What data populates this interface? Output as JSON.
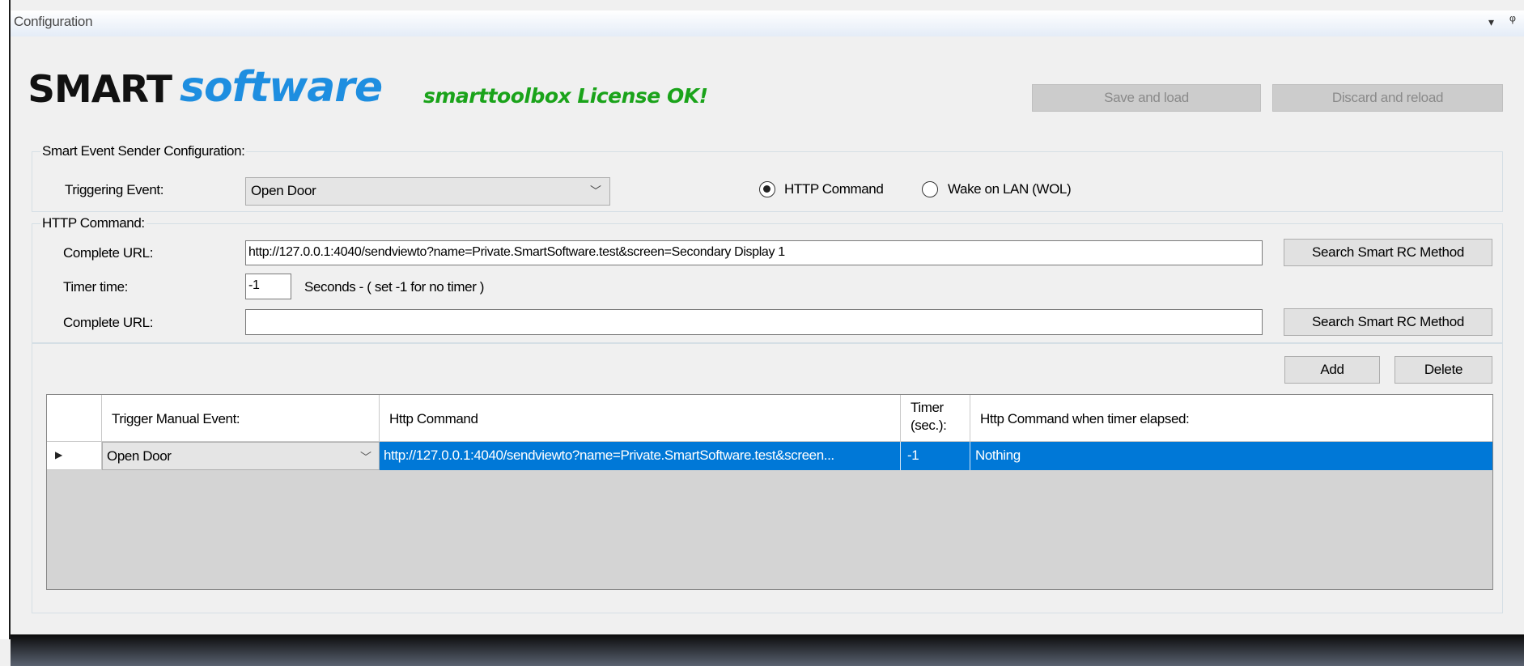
{
  "window": {
    "title": "Configuration",
    "dropdown_glyph": "▾",
    "pin_glyph": "ᵠ"
  },
  "header": {
    "logo_smart": "SMART",
    "logo_software": "software",
    "license_status": "smarttoolbox License OK!",
    "save_button": "Save and load",
    "discard_button": "Discard and reload"
  },
  "sender_config": {
    "group_label": "Smart Event Sender Configuration:",
    "triggering_event_label": "Triggering Event:",
    "triggering_event_value": "Open Door",
    "radio_http_label": "HTTP Command",
    "radio_http_checked": true,
    "radio_wol_label": "Wake on LAN (WOL)",
    "radio_wol_checked": false
  },
  "http_command": {
    "group_label": "HTTP Command:",
    "complete_url_label": "Complete URL:",
    "complete_url_value": "http://127.0.0.1:4040/sendviewto?name=Private.SmartSoftware.test&screen=Secondary Display 1",
    "search_button_1": "Search Smart RC Method",
    "timer_label": "Timer time:",
    "timer_value": "-1",
    "timer_hint": "Seconds  -  ( set -1 for no timer )",
    "complete_url_2_label": "Complete URL:",
    "complete_url_2_value": "",
    "search_button_2": "Search Smart RC Method"
  },
  "grid_actions": {
    "add_button": "Add",
    "delete_button": "Delete"
  },
  "grid": {
    "columns": [
      "Trigger Manual Event:",
      "Http Command",
      "Timer (sec.):",
      "Http Command when timer elapsed:"
    ],
    "timer_header_line1": "Timer",
    "timer_header_line2": "(sec.):",
    "rows": [
      {
        "selected": true,
        "trigger": "Open Door",
        "http_command": "http://127.0.0.1:4040/sendviewto?name=Private.SmartSoftware.test&screen...",
        "timer": "-1",
        "elapsed_command": "Nothing"
      }
    ]
  },
  "colors": {
    "logo_blue": "#1e8ee0",
    "license_green": "#1aa31a",
    "selection_blue": "#0078d7"
  }
}
